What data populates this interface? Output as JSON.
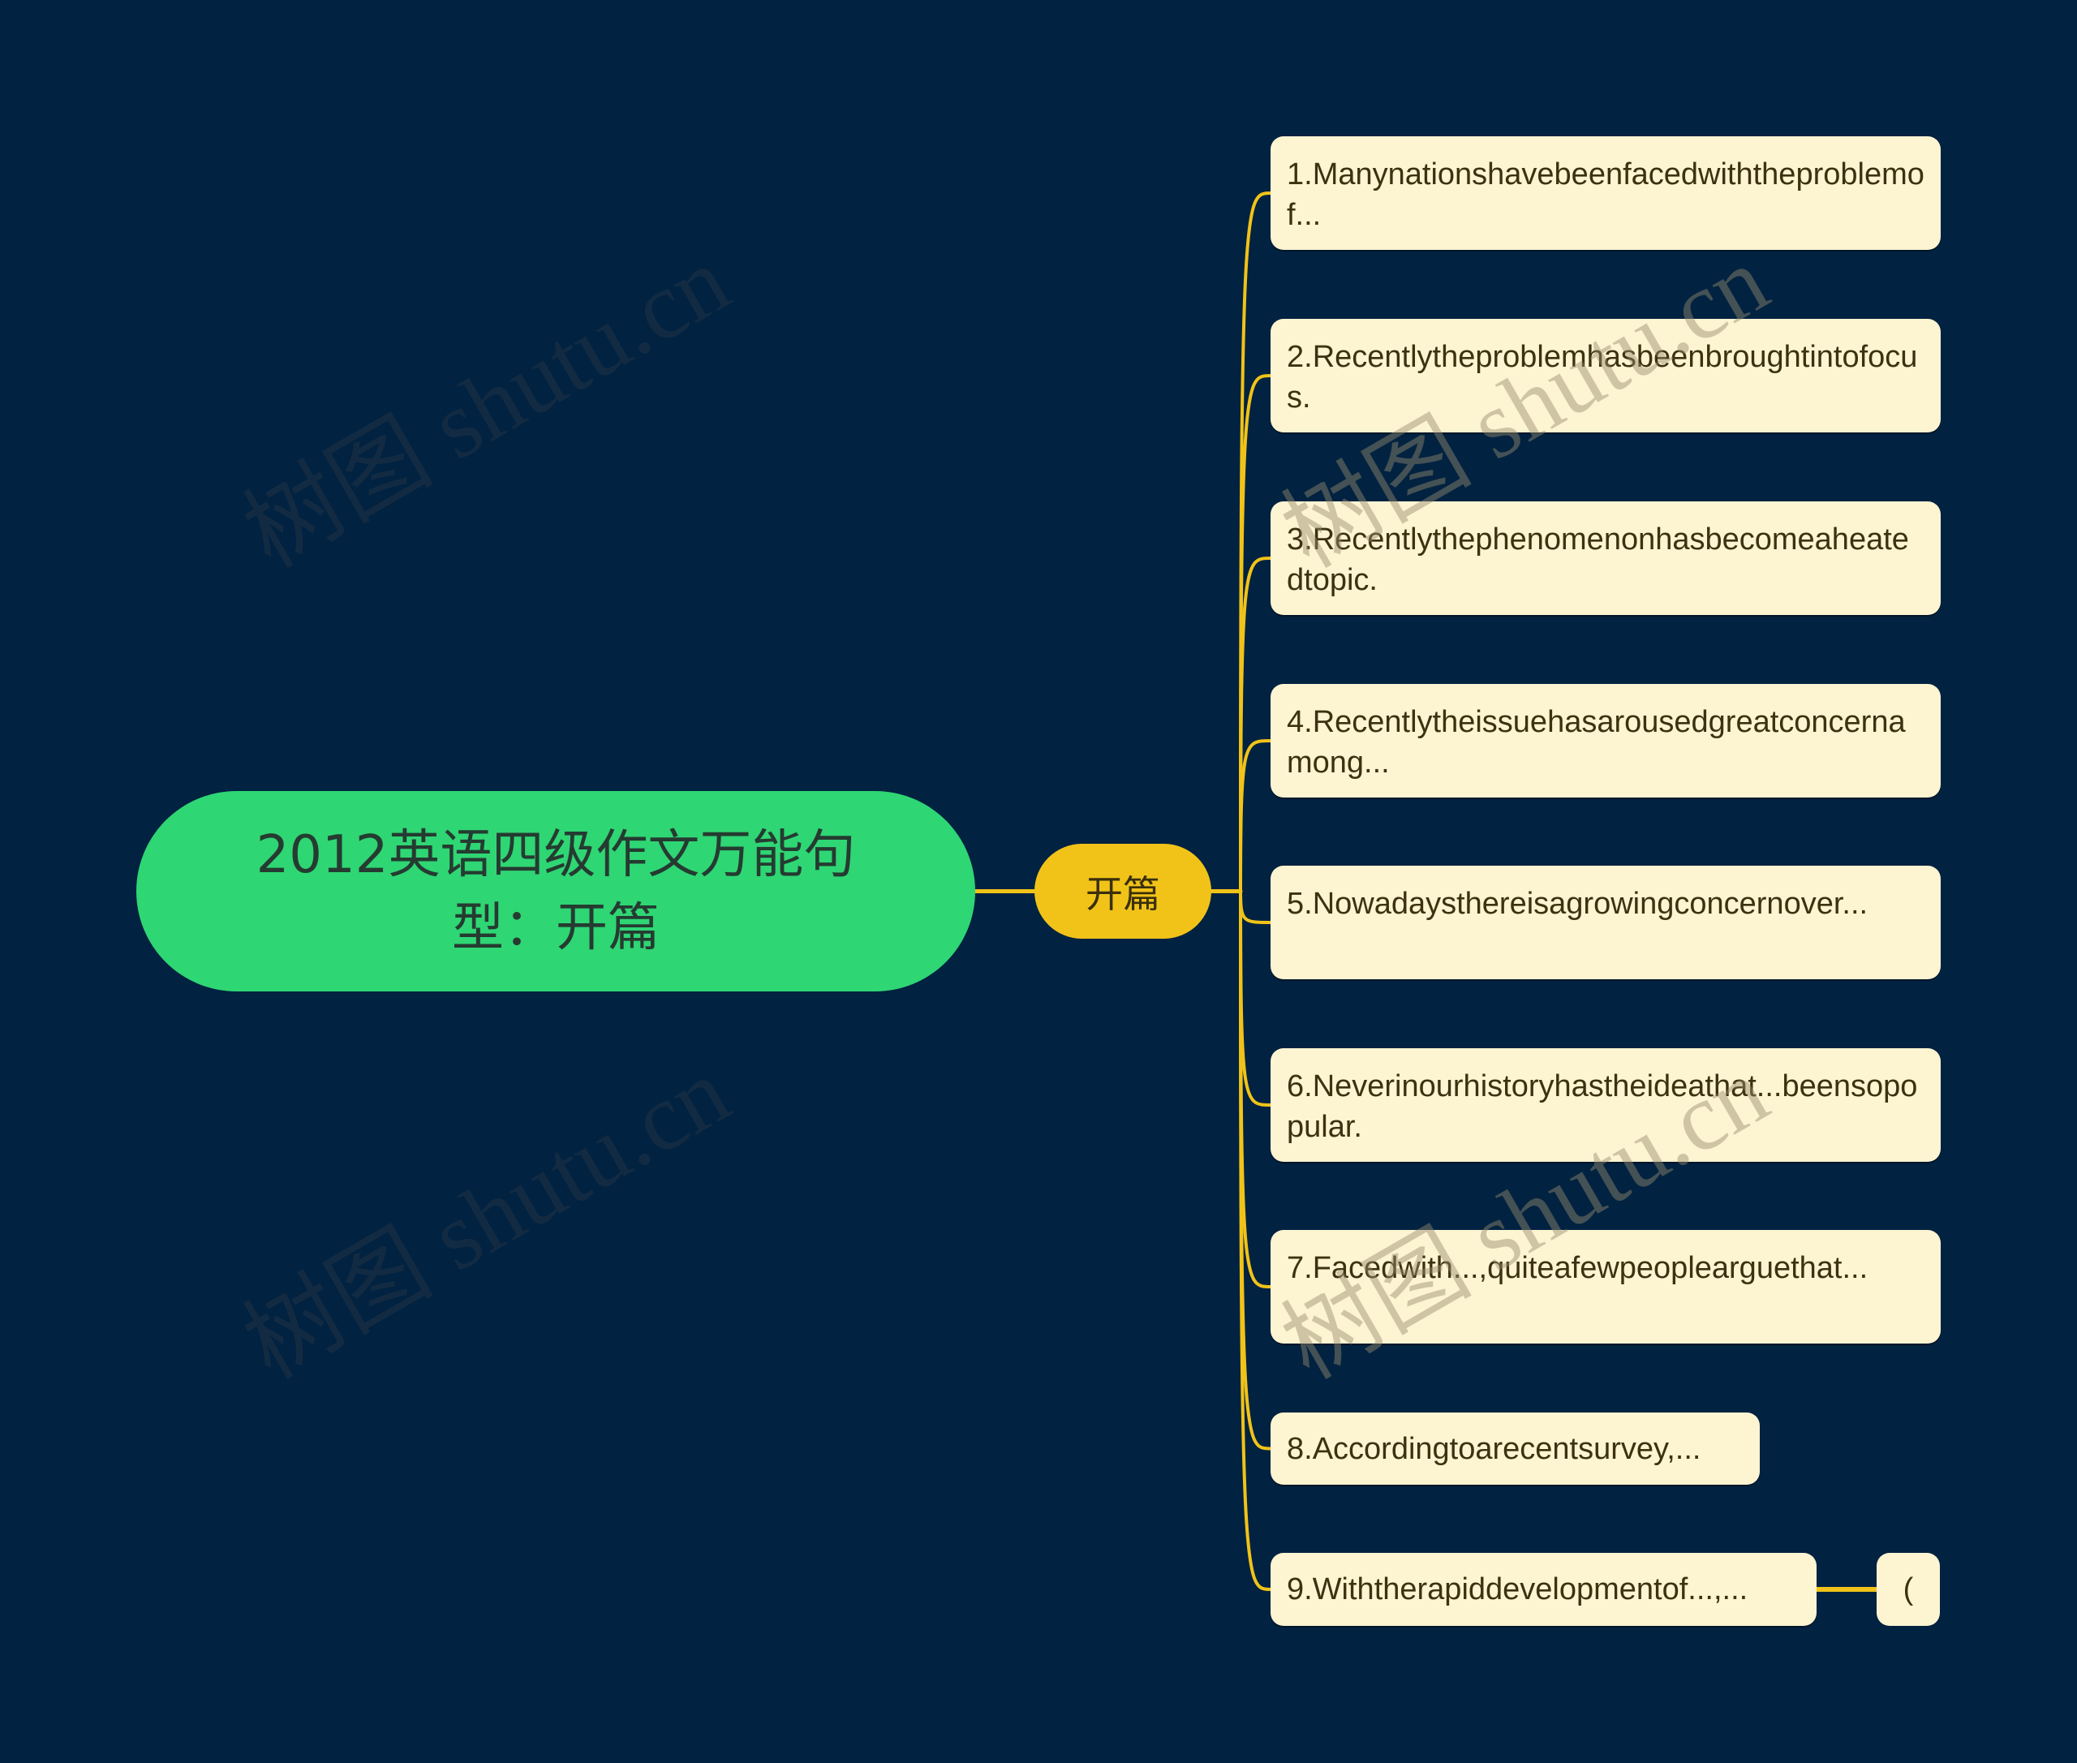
{
  "mindmap": {
    "root": {
      "label": "2012英语四级作文万能句型：开篇",
      "color": "#2fd674"
    },
    "branch": {
      "label": "开篇",
      "color": "#f1c319"
    },
    "leaves": [
      {
        "label": "1.Manynationshavebeenfacedwiththeproblemof..."
      },
      {
        "label": "2.Recentlytheproblemhasbeenbroughtintofocus."
      },
      {
        "label": "3.Recentlythephenomenonhasbecomeaheatedtopic."
      },
      {
        "label": "4.Recentlytheissuehasarousedgreatconcernamong..."
      },
      {
        "label": "5.Nowadaysthereisagrowingconcernover..."
      },
      {
        "label": "6.Neverinourhistoryhastheideathat...beensopopular."
      },
      {
        "label": "7.Facedwith...,quiteafewpeoplearguethat..."
      },
      {
        "label": "8.Accordingtoarecentsurvey,..."
      },
      {
        "label": "9.Withtherapiddevelopmentof...,..."
      }
    ],
    "tail": {
      "label": "("
    },
    "leaf_color": "#fdf4d2",
    "line_color": "#f1c319",
    "background": "#012240"
  },
  "watermark": {
    "text": "树图 shutu.cn"
  }
}
